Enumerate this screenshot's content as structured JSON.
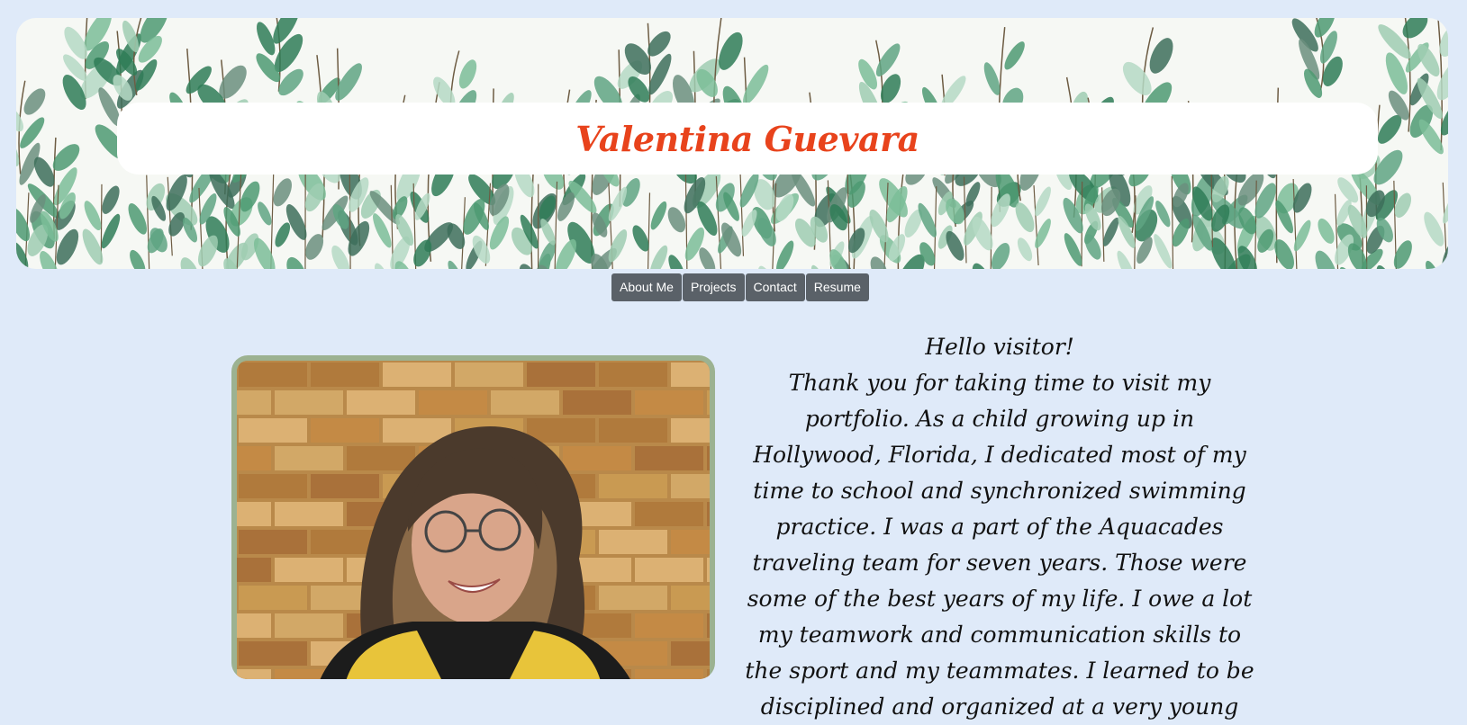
{
  "header": {
    "site_title": "Valentina Guevara"
  },
  "nav": {
    "items": [
      {
        "label": "About Me"
      },
      {
        "label": "Projects"
      },
      {
        "label": "Contact"
      },
      {
        "label": "Resume"
      }
    ]
  },
  "about": {
    "greeting": "Hello visitor!",
    "body": "Thank you for taking time to visit my portfolio. As a child growing up in Hollywood, Florida, I dedicated most of my time to school and synchronized swimming practice. I was a part of the Aquacades traveling team for seven years. Those were some of the best years of my life. I owe a lot my teamwork and communication skills to the sport and my teammates. I learned to be disciplined and organized at a very young"
  },
  "colors": {
    "page_background": "#dfeaf9",
    "title": "#e8431c",
    "nav_button": "#5a6168",
    "photo_frame": "#9cb291"
  }
}
